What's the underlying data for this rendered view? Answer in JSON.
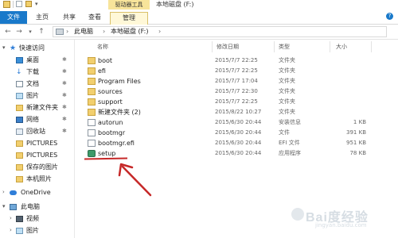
{
  "window": {
    "title": "本地磁盘 (F:)",
    "tool_tab": "驱动器工具"
  },
  "ribbon": {
    "tabs": [
      "文件",
      "主页",
      "共享",
      "查看",
      "管理"
    ]
  },
  "address": {
    "crumbs": [
      "此电脑",
      "本地磁盘 (F:)"
    ]
  },
  "columns": {
    "name": "名称",
    "date": "修改日期",
    "type": "类型",
    "size": "大小"
  },
  "nav": {
    "items": [
      {
        "label": "快速访问",
        "icon": "star-icon"
      },
      {
        "label": "桌面",
        "icon": "desktop-icon"
      },
      {
        "label": "下载",
        "icon": "download-icon"
      },
      {
        "label": "文档",
        "icon": "document-icon"
      },
      {
        "label": "图片",
        "icon": "picture-icon"
      },
      {
        "label": "新建文件夹",
        "icon": "folder-icon"
      },
      {
        "label": "网络",
        "icon": "network-icon"
      },
      {
        "label": "回收站",
        "icon": "recycle-bin-icon"
      },
      {
        "label": "PICTURES",
        "icon": "folder-icon"
      },
      {
        "label": "PICTURES",
        "icon": "folder-icon"
      },
      {
        "label": "保存的图片",
        "icon": "folder-icon"
      },
      {
        "label": "本机照片",
        "icon": "folder-icon"
      },
      {
        "label": "OneDrive",
        "icon": "cloud-icon"
      },
      {
        "label": "此电脑",
        "icon": "computer-icon"
      },
      {
        "label": "视频",
        "icon": "video-icon"
      },
      {
        "label": "图片",
        "icon": "picture-icon"
      }
    ]
  },
  "files": [
    {
      "name": "boot",
      "date": "2015/7/7 22:25",
      "type": "文件夹",
      "size": "",
      "icon": "folder-icon"
    },
    {
      "name": "efi",
      "date": "2015/7/7 22:25",
      "type": "文件夹",
      "size": "",
      "icon": "folder-icon"
    },
    {
      "name": "Program Files",
      "date": "2015/7/7 17:04",
      "type": "文件夹",
      "size": "",
      "icon": "folder-icon"
    },
    {
      "name": "sources",
      "date": "2015/7/7 22:30",
      "type": "文件夹",
      "size": "",
      "icon": "folder-icon"
    },
    {
      "name": "support",
      "date": "2015/7/7 22:25",
      "type": "文件夹",
      "size": "",
      "icon": "folder-icon"
    },
    {
      "name": "新建文件夹 (2)",
      "date": "2015/8/22 10:27",
      "type": "文件夹",
      "size": "",
      "icon": "folder-icon"
    },
    {
      "name": "autorun",
      "date": "2015/6/30 20:44",
      "type": "安装信息",
      "size": "1 KB",
      "icon": "setup-info-icon"
    },
    {
      "name": "bootmgr",
      "date": "2015/6/30 20:44",
      "type": "文件",
      "size": "391 KB",
      "icon": "file-icon"
    },
    {
      "name": "bootmgr.efi",
      "date": "2015/6/30 20:44",
      "type": "EFI 文件",
      "size": "951 KB",
      "icon": "file-icon"
    },
    {
      "name": "setup",
      "date": "2015/6/30 20:44",
      "type": "应用程序",
      "size": "78 KB",
      "icon": "setup-app-icon"
    }
  ],
  "watermark": {
    "text": "Bai度经验",
    "sub": "jingyan.baidu.com"
  },
  "colors": {
    "file_tab": "#1979ca",
    "folder": "#f2cf6e",
    "annotation": "#c62828"
  }
}
